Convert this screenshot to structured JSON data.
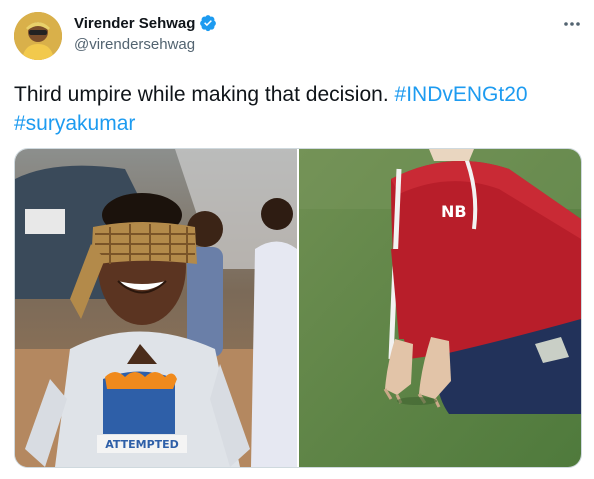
{
  "author": {
    "display_name": "Virender Sehwag",
    "handle": "@virendersehwag",
    "verified": true,
    "avatar_icon": "avatar-image"
  },
  "tweet": {
    "text_plain": "Third umpire while making that decision. ",
    "hashtags": [
      "#INDvENGt20",
      "#suryakumar"
    ]
  },
  "media": {
    "left_image_caption_text": "ATTEMPTED",
    "right_image_shirt_text": "NB"
  },
  "colors": {
    "link": "#1d9bf0",
    "verified": "#1d9bf0",
    "secondary_text": "#536471"
  },
  "icons": [
    "verified-badge-icon",
    "more-options-icon"
  ]
}
